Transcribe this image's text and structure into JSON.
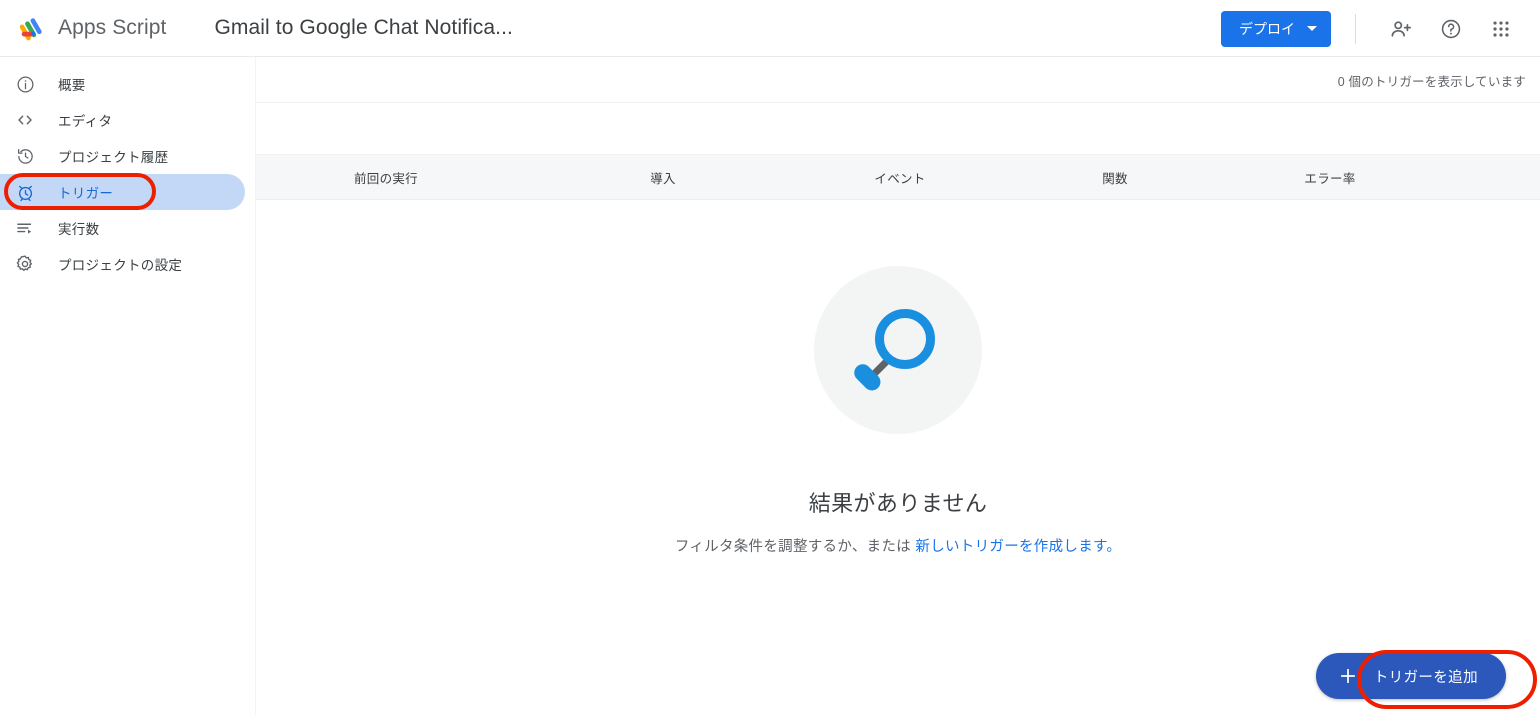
{
  "topbar": {
    "logo_icon": "apps-script-logo",
    "brand_name": "Apps Script",
    "project_title": "Gmail to Google Chat Notifica...",
    "deploy_label": "デプロイ",
    "deploy_caret_icon": "chevron-down-icon",
    "deploy_color": "#1a73e8",
    "icons": [
      {
        "name": "person-add-icon",
        "label": "共有"
      },
      {
        "name": "help-circle-icon",
        "label": "ヘルプ"
      },
      {
        "name": "apps-grid-icon",
        "label": "Google アプリ"
      }
    ]
  },
  "sidebar": {
    "items": [
      {
        "label": "概要",
        "icon": "info-circle-icon",
        "selected": false
      },
      {
        "label": "エディタ",
        "icon": "code-brackets-icon",
        "selected": false
      },
      {
        "label": "プロジェクト履歴",
        "icon": "history-clock-icon",
        "selected": false
      },
      {
        "label": "トリガー",
        "icon": "alarm-clock-icon",
        "selected": true
      },
      {
        "label": "実行数",
        "icon": "executions-list-icon",
        "selected": false
      },
      {
        "label": "プロジェクトの設定",
        "icon": "gear-icon",
        "selected": false
      }
    ],
    "selected_bg": "#c3d8f7",
    "selected_text_color": "#1967d2"
  },
  "main": {
    "trigger_count_text": "0 個のトリガーを表示しています",
    "table_headers": [
      "前回の実行",
      "導入",
      "イベント",
      "関数",
      "エラー率"
    ],
    "empty_state": {
      "illustration_icon": "magnifier-icon",
      "illustration_circle_color": "#f3f4f4",
      "illustration_accent_color": "#1a8fe0",
      "title": "結果がありません",
      "subtitle_prefix": "フィルタ条件を調整するか、または ",
      "subtitle_link": "新しいトリガーを作成します。",
      "link_color": "#1a73e8"
    },
    "add_trigger": {
      "label": "トリガーを追加",
      "icon": "plus-icon",
      "color": "#2c57bb"
    }
  },
  "annotations": {
    "color": "#ec2000",
    "shapes": [
      {
        "name": "sidebar-trigger-highlight",
        "target": "トリガー"
      },
      {
        "name": "add-trigger-highlight",
        "target": "トリガーを追加"
      }
    ]
  }
}
